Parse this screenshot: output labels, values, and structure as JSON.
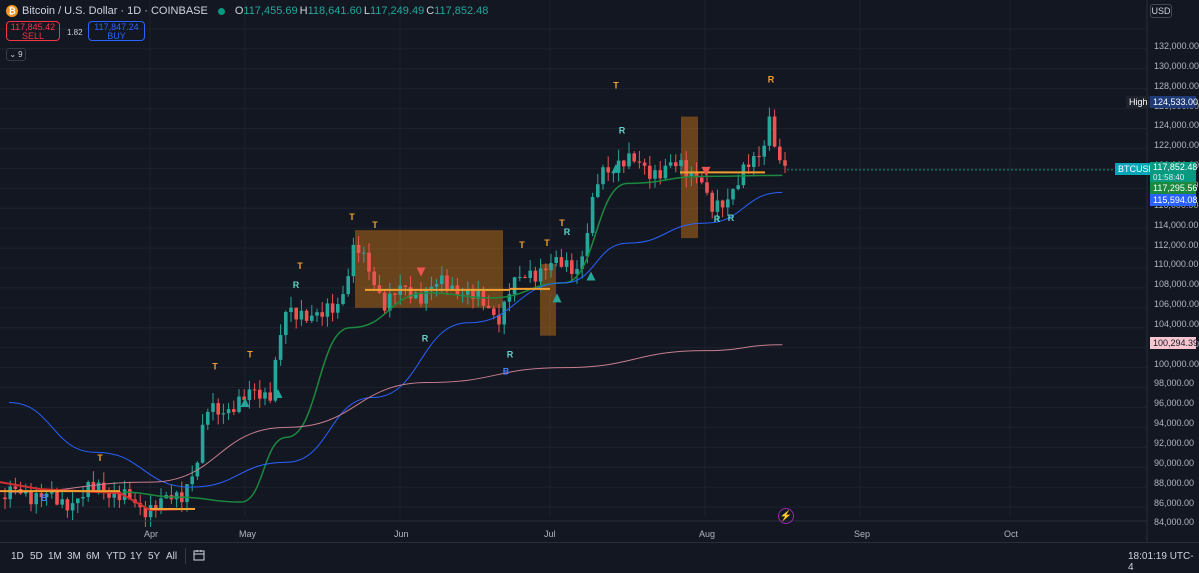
{
  "header": {
    "logo_glyph": "₿",
    "title": "Bitcoin / U.S. Dollar · 1D · COINBASE",
    "open_label": "O",
    "open": "117,455.69",
    "high_label": "H",
    "high": "118,641.60",
    "low_label": "L",
    "low": "117,249.49",
    "close_label": "C",
    "close": "117,852.48"
  },
  "trade": {
    "sell_price": "117,845.42",
    "sell_label": "SELL",
    "spread": "1.82",
    "buy_price": "117,847.24",
    "buy_label": "BUY"
  },
  "indicators_badge": {
    "chevron": "⌄",
    "count": "9"
  },
  "currency": "USD",
  "price_axis": [
    "132,000.00",
    "130,000.00",
    "128,000.00",
    "126,000.00",
    "124,000.00",
    "122,000.00",
    "120,000.00",
    "118,000.00",
    "116,000.00",
    "114,000.00",
    "112,000.00",
    "110,000.00",
    "108,000.00",
    "106,000.00",
    "104,000.00",
    "102,000.00",
    "100,000.00",
    "98,000.00",
    "96,000.00",
    "94,000.00",
    "92,000.00",
    "90,000.00",
    "88,000.00",
    "86,000.00",
    "84,000.00"
  ],
  "price_labels": {
    "high_tag": "High",
    "high_value": "124,533.00",
    "symbol": "BTCUSD",
    "last": "117,852.48",
    "countdown": "01:58:40",
    "ma_fast": "117,295.56",
    "ma_mid": "115,594.08",
    "ma_slow": "100,294.39"
  },
  "time_axis": [
    "Apr",
    "May",
    "Jun",
    "Jul",
    "Aug",
    "Sep",
    "Oct"
  ],
  "bottom_bar": {
    "ranges": [
      "1D",
      "5D",
      "1M",
      "3M",
      "6M",
      "YTD",
      "1Y",
      "5Y",
      "All"
    ],
    "clock": "18:01:19 UTC-4"
  },
  "colors": {
    "background": "#131722",
    "up": "#26a69a",
    "down": "#ef5350",
    "ma_fast": "#1b8a3f",
    "ma_mid": "#2962ff",
    "ma_slow": "#c67e8e",
    "zone": "#b06818",
    "signal_t": "#f0a030",
    "signal_r": "#5fd3c8",
    "signal_b": "#4a7dff"
  },
  "chart_data": {
    "type": "candlestick",
    "symbol": "BTCUSD",
    "ylim": [
      83000,
      133500
    ],
    "markers_text": [
      "T",
      "R",
      "B"
    ],
    "series": [
      {
        "name": "fast_ma",
        "x": [
          "2025-03-26",
          "2025-04-07",
          "2025-04-21",
          "2025-05-01",
          "2025-05-15",
          "2025-06-01",
          "2025-06-15",
          "2025-07-01",
          "2025-07-15",
          "2025-08-01",
          "2025-08-18"
        ],
        "y": [
          85500,
          85000,
          84500,
          91000,
          102000,
          105500,
          105000,
          106500,
          116500,
          117200,
          117295
        ]
      },
      {
        "name": "mid_ma",
        "x": [
          "2025-03-01",
          "2025-03-20",
          "2025-04-10",
          "2025-05-01",
          "2025-05-20",
          "2025-06-10",
          "2025-07-01",
          "2025-07-15",
          "2025-08-01",
          "2025-08-18"
        ],
        "y": [
          94500,
          89500,
          86000,
          88500,
          95000,
          102500,
          106500,
          110500,
          112500,
          115594
        ]
      },
      {
        "name": "slow_ma",
        "x": [
          "2025-03-01",
          "2025-04-01",
          "2025-05-01",
          "2025-06-01",
          "2025-07-01",
          "2025-08-01",
          "2025-08-18"
        ],
        "y": [
          85500,
          86500,
          92000,
          96500,
          98000,
          99700,
          100294
        ]
      }
    ]
  }
}
